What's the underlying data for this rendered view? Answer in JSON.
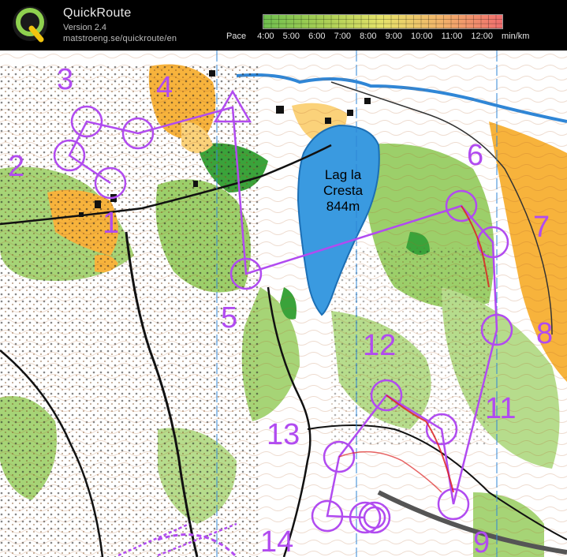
{
  "app": {
    "name": "QuickRoute",
    "version": "Version 2.4",
    "url": "matstroeng.se/quickroute/en",
    "logo_letter": "Q"
  },
  "pace": {
    "label": "Pace",
    "ticks": [
      "4:00",
      "5:00",
      "6:00",
      "7:00",
      "8:00",
      "9:00",
      "10:00",
      "11:00",
      "12:00"
    ],
    "unit": "min/km",
    "colors": [
      "#6fbf4f",
      "#a8cf54",
      "#e6e26a",
      "#f2b26a",
      "#ef6e6e"
    ]
  },
  "map": {
    "lake_name": "Lag la",
    "lake_name2": "Cresta",
    "lake_elevation": "844m",
    "controls": [
      "1",
      "2",
      "3",
      "4",
      "5",
      "6",
      "7",
      "8",
      "9",
      "11",
      "12",
      "13",
      "14"
    ],
    "colors": {
      "terrain_white": "#ffffff",
      "forest_green": "#9ccf6a",
      "dark_green": "#3aa33a",
      "open_yellow": "#f7b33c",
      "water": "#3a9ae0",
      "contour": "#b0602a",
      "course": "#b14bf0"
    }
  }
}
